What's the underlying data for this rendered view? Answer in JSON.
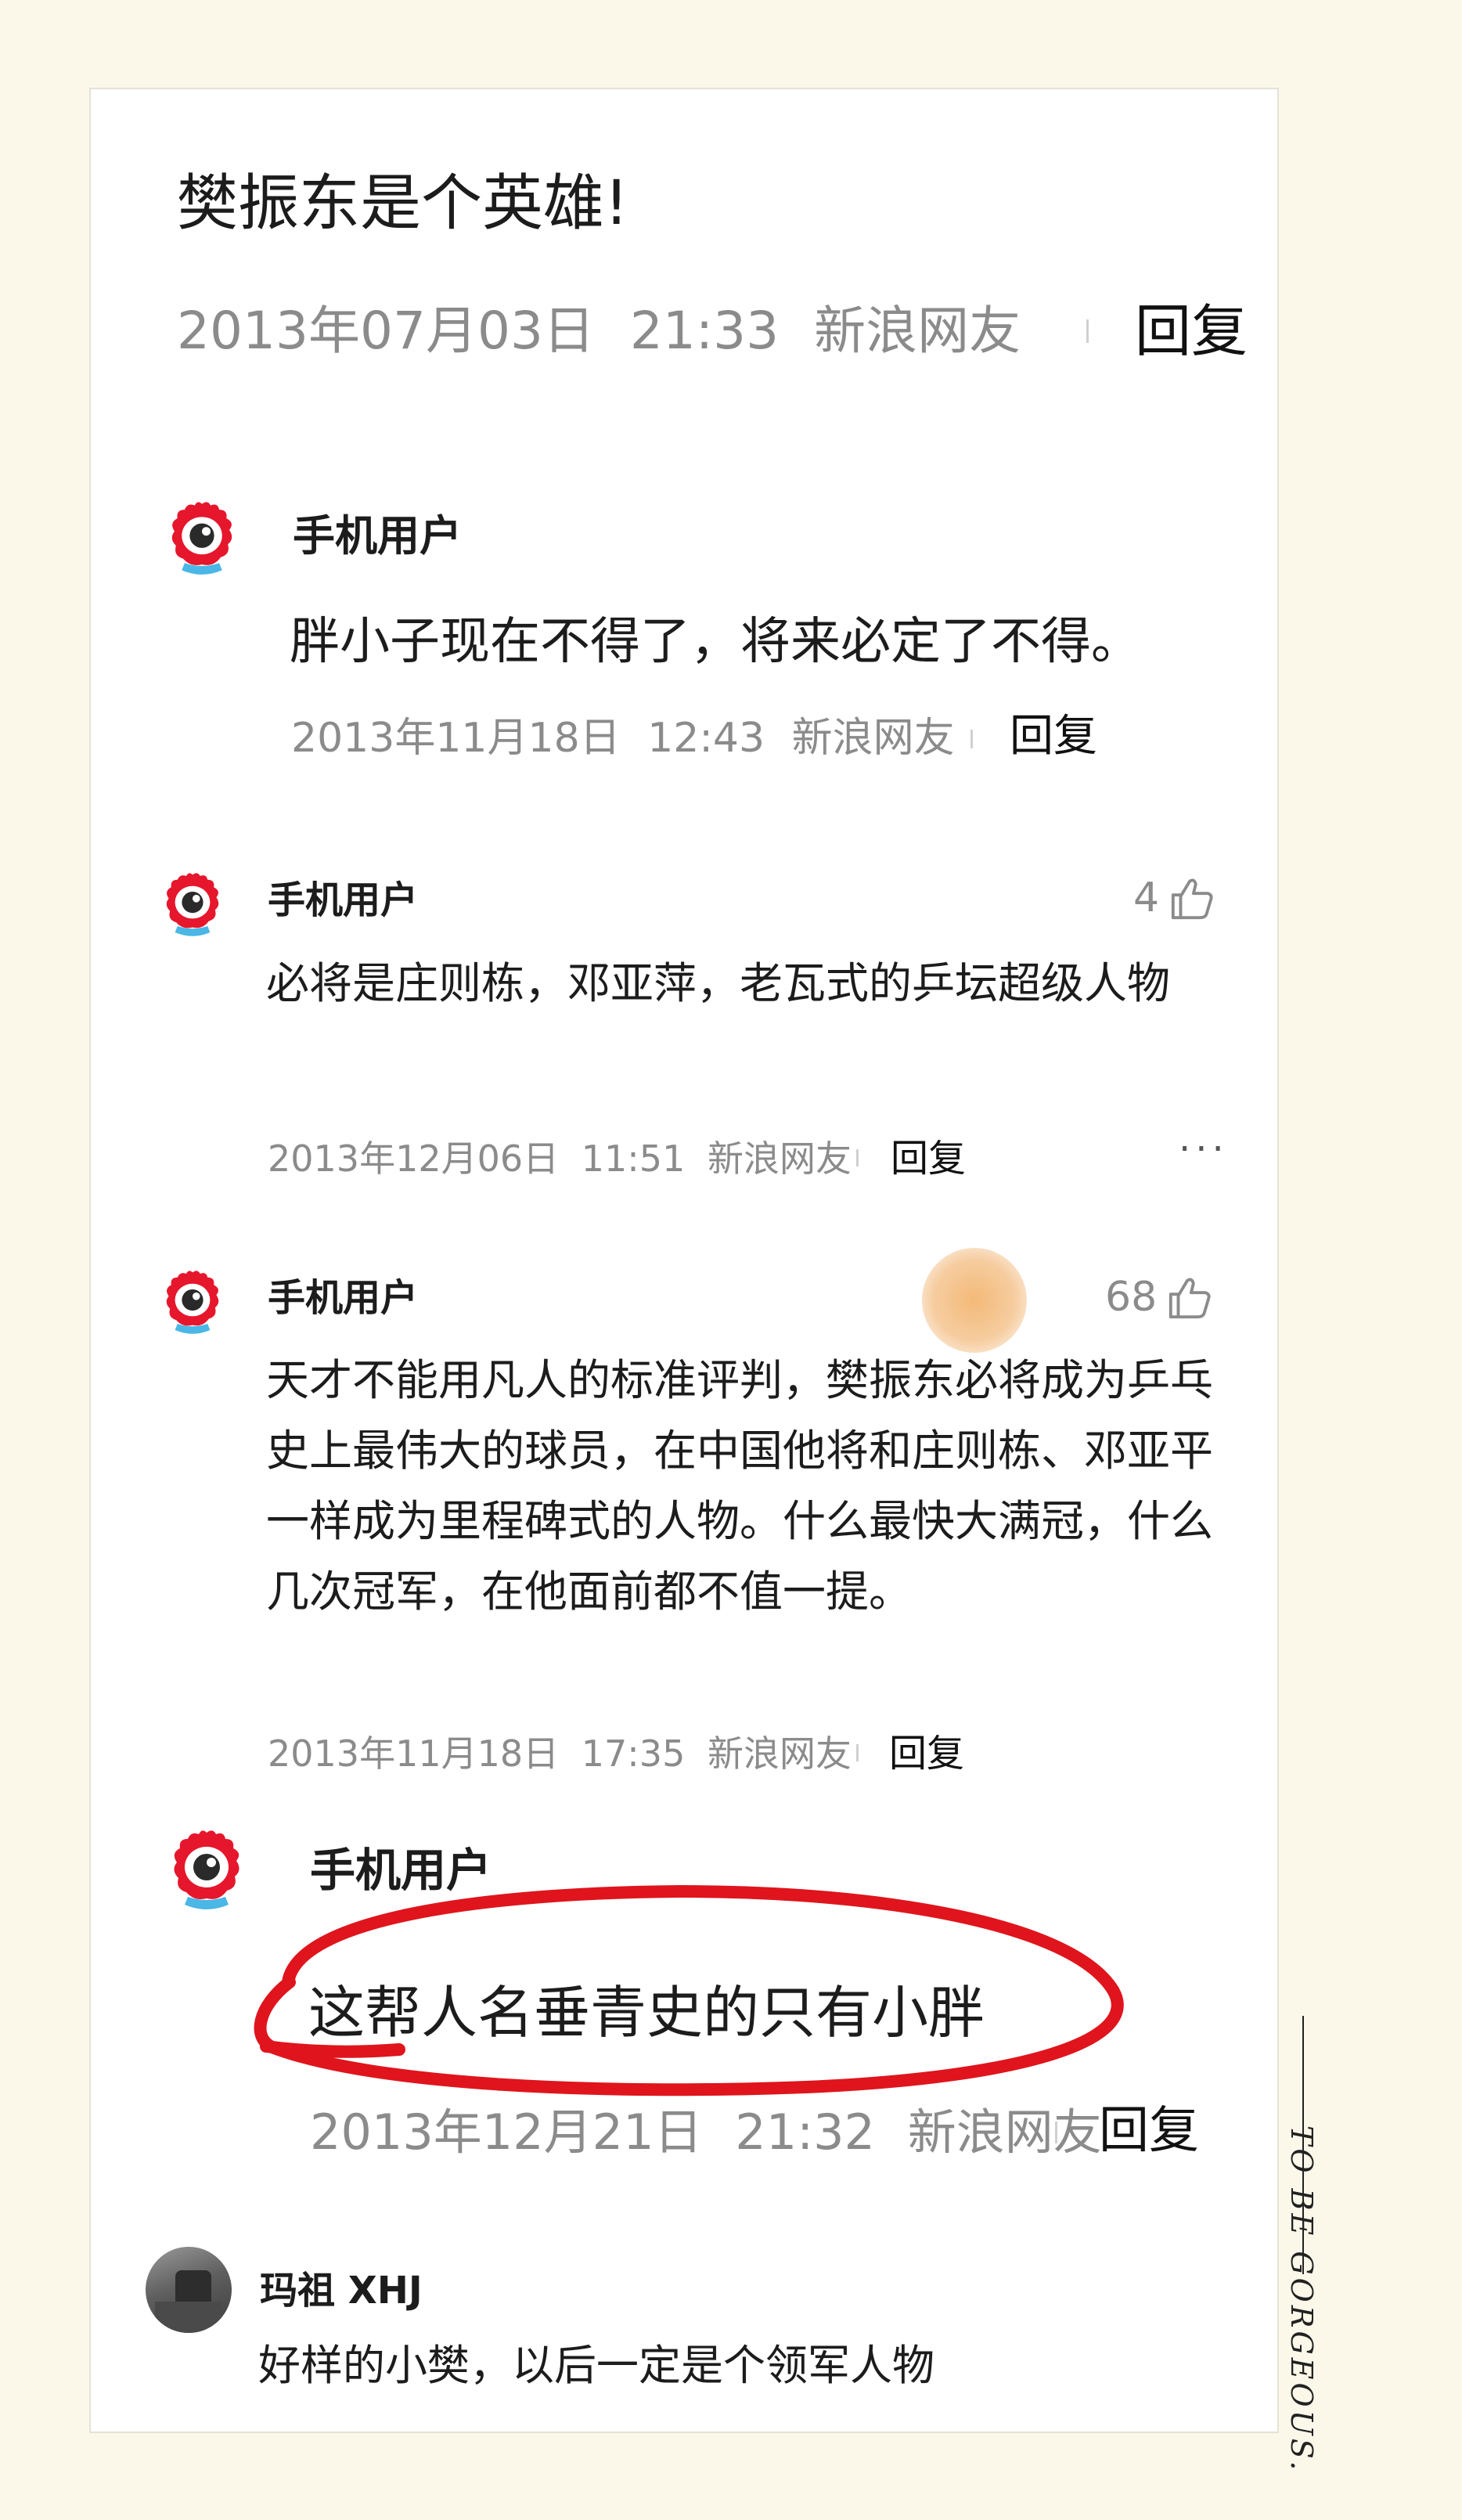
{
  "title": "樊振东是个英雄!",
  "header": {
    "date": "2013年07月03日",
    "time": "21:33",
    "source": "新浪网友",
    "reply_label": "回复"
  },
  "comments": [
    {
      "user": "手机用户",
      "text": "胖小子现在不得了，将来必定了不得。",
      "date": "2013年11月18日",
      "time": "12:43",
      "source": "新浪网友",
      "reply_label": "回复"
    },
    {
      "user": "手机用户",
      "likes": "4",
      "text": "必将是庄则栋，邓亚萍，老瓦式的乒坛超级人物",
      "date": "2013年12月06日",
      "time": "11:51",
      "source": "新浪网友",
      "reply_label": "回复",
      "more": "···"
    },
    {
      "user": "手机用户",
      "likes": "68",
      "text": "天才不能用凡人的标准评判，樊振东必将成为乒乓史上最伟大的球员，在中国他将和庄则栋、邓亚平一样成为里程碑式的人物。什么最快大满冠，什么几次冠军，在他面前都不值一提。",
      "date": "2013年11月18日",
      "time": "17:35",
      "source": "新浪网友",
      "reply_label": "回复"
    },
    {
      "user": "手机用户",
      "text": "这帮人名垂青史的只有小胖",
      "date": "2013年12月21日",
      "time": "21:32",
      "source": "新浪网友",
      "reply_label": "回复"
    },
    {
      "user": "玛祖 XHJ",
      "text": "好样的小樊，以后一定是个领军人物"
    }
  ],
  "side_caption": "TO BE GORGEOUS.",
  "colors": {
    "background": "#fbf8ea",
    "card": "#ffffff",
    "meta": "#8b8b8b",
    "highlight_circle": "#e0141c",
    "weibo_red": "#e6162d",
    "weibo_blue": "#4ab7e6"
  },
  "icons": {
    "avatar": "weibo-eye-icon",
    "like": "thumb-up-icon",
    "more": "ellipsis-icon"
  }
}
